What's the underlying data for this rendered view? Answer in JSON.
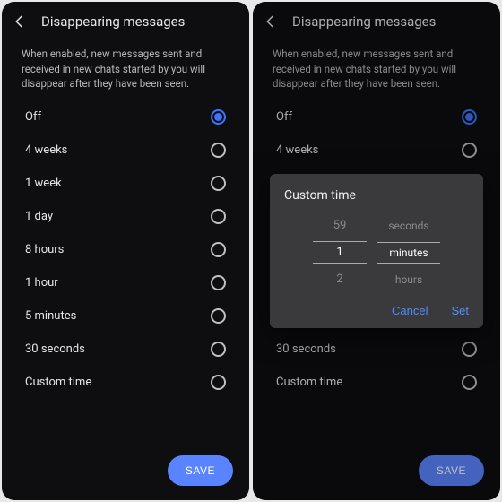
{
  "header": {
    "title": "Disappearing messages"
  },
  "description": "When enabled, new messages sent and received in new chats started by you will disappear after they have been seen.",
  "options": [
    {
      "label": "Off",
      "selected": true
    },
    {
      "label": "4 weeks",
      "selected": false
    },
    {
      "label": "1 week",
      "selected": false
    },
    {
      "label": "1 day",
      "selected": false
    },
    {
      "label": "8 hours",
      "selected": false
    },
    {
      "label": "1 hour",
      "selected": false
    },
    {
      "label": "5 minutes",
      "selected": false
    },
    {
      "label": "30 seconds",
      "selected": false
    },
    {
      "label": "Custom time",
      "selected": false
    }
  ],
  "save_label": "SAVE",
  "dialog": {
    "title": "Custom time",
    "prev_value": "59",
    "prev_unit": "seconds",
    "active_value": "1",
    "active_unit": "minutes",
    "next_value": "2",
    "next_unit": "hours",
    "cancel": "Cancel",
    "set": "Set"
  }
}
